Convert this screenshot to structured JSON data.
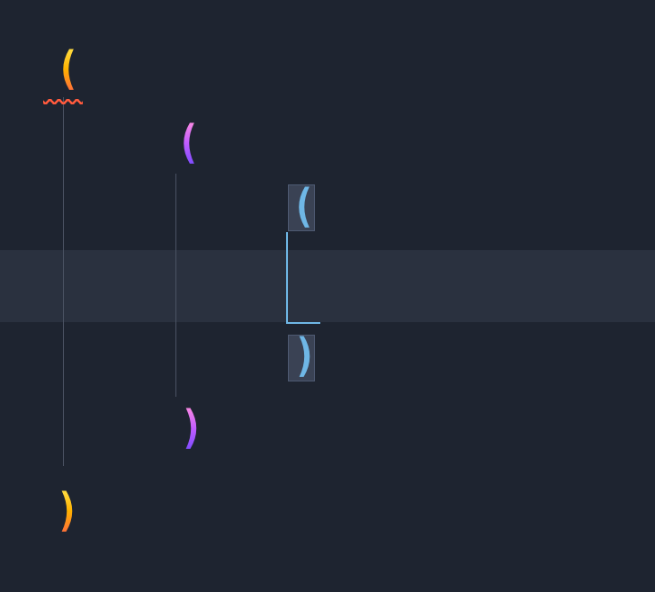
{
  "editor": {
    "background": "#1e2430",
    "line_highlight_bg": "#2a313f",
    "indent_guide_color": "#4b5363",
    "rainbow_levels": [
      {
        "level": 1,
        "colors": [
          "#ffe24a",
          "#ffb200",
          "#ff6a3d"
        ]
      },
      {
        "level": 2,
        "colors": [
          "#ff8de0",
          "#c15cff",
          "#7a4bff"
        ]
      },
      {
        "level": 3,
        "colors": [
          "#6fb7e6"
        ]
      }
    ],
    "bracket_match_highlight": "#3a4254",
    "bracket_scope_line_color": "#6fb7e6",
    "error_squiggle_color": "#ff5a3d"
  },
  "code": {
    "tokens": [
      {
        "kind": "paren_open",
        "level": 1,
        "text": "(",
        "line": 1,
        "col": 1,
        "error": true
      },
      {
        "kind": "paren_open",
        "level": 2,
        "text": "(",
        "line": 2,
        "col": 2
      },
      {
        "kind": "paren_open",
        "level": 3,
        "text": "(",
        "line": 3,
        "col": 3,
        "matched": true
      },
      {
        "kind": "empty",
        "line": 4
      },
      {
        "kind": "paren_close",
        "level": 3,
        "text": ")",
        "line": 5,
        "col": 3,
        "matched": true
      },
      {
        "kind": "paren_close",
        "level": 2,
        "text": ")",
        "line": 6,
        "col": 2
      },
      {
        "kind": "paren_close",
        "level": 1,
        "text": ")",
        "line": 7,
        "col": 1
      }
    ]
  }
}
